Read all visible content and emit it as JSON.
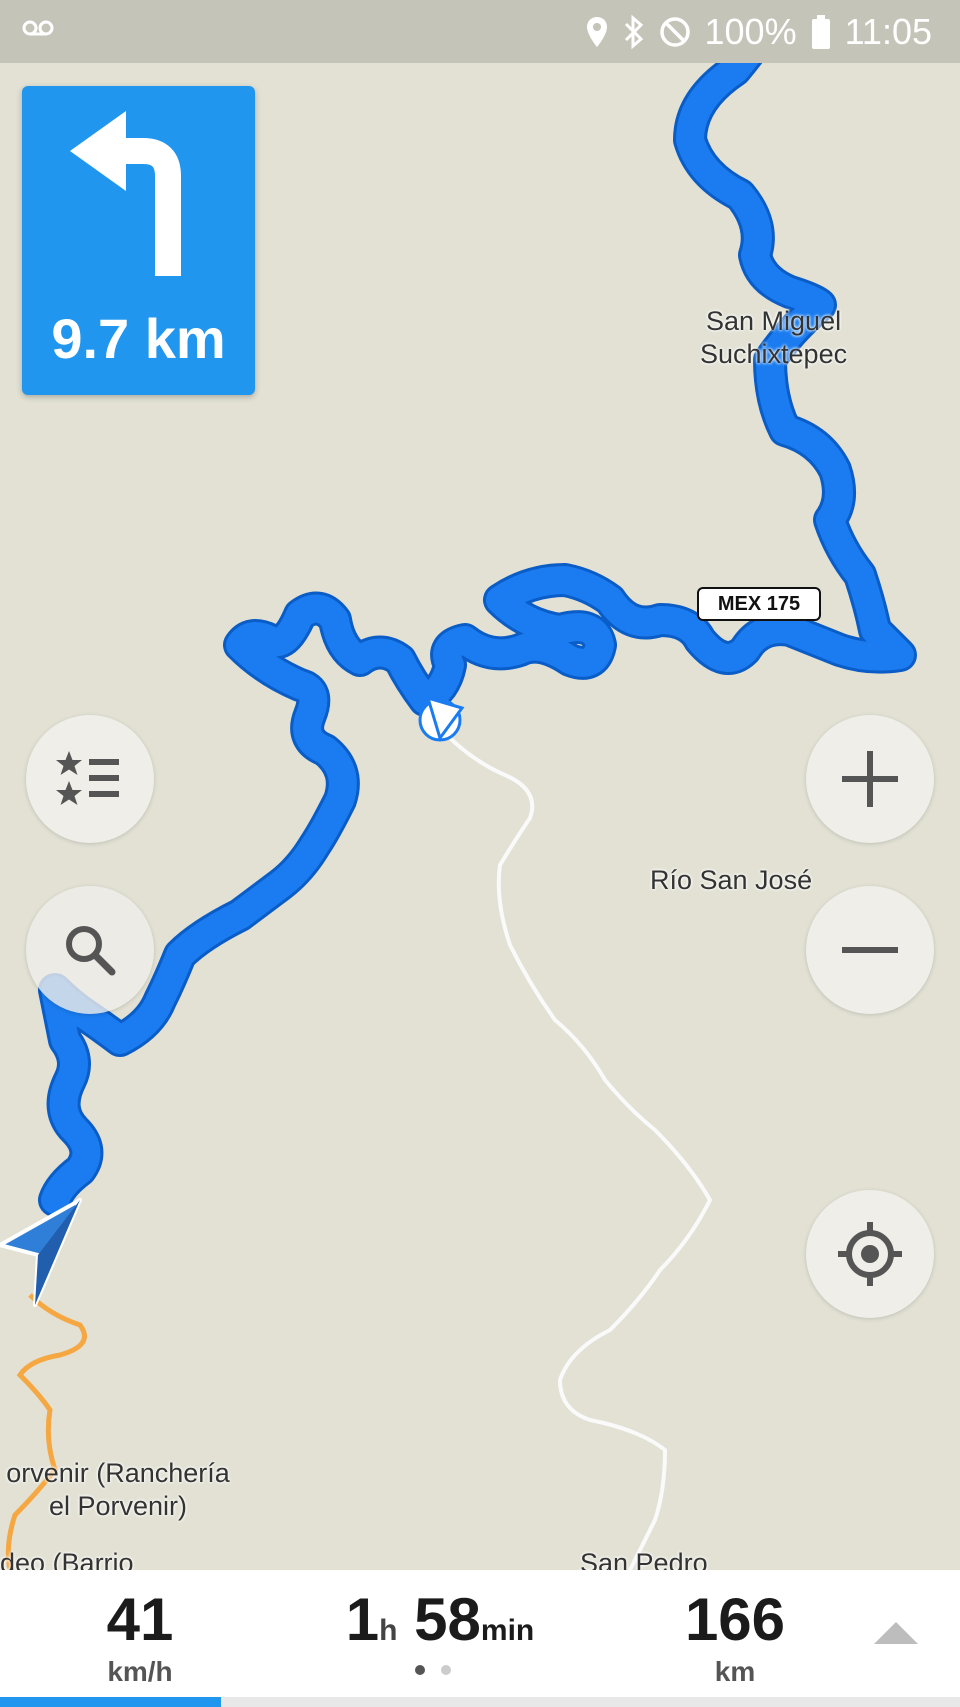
{
  "status_bar": {
    "battery": "100%",
    "time": "11:05",
    "icons": [
      "voicemail-icon",
      "location-icon",
      "bluetooth-icon",
      "do-not-disturb-icon",
      "battery-icon"
    ]
  },
  "navigation": {
    "turn_icon": "turn-left-arrow-icon",
    "turn_distance": "9.7 km"
  },
  "map": {
    "labels": {
      "san_miguel_1": "San Miguel",
      "san_miguel_2": "Suchixtepec",
      "rio_san_jose": "Río San José",
      "porvenir_1": "orvenir (Ranchería",
      "porvenir_2": "el Porvenir)",
      "deo": "deo (Barrio",
      "san_pedro": "San Pedro"
    },
    "road_shield": "MEX 175",
    "route_color": "#1a7cf0",
    "side_road_color": "#f5a742"
  },
  "controls": {
    "favorites_icon": "favorites-list-icon",
    "search_icon": "search-icon",
    "zoom_in_icon": "plus-icon",
    "zoom_out_icon": "minus-icon",
    "locate_icon": "my-location-icon"
  },
  "trip": {
    "speed_value": "41",
    "speed_unit": "km/h",
    "eta_hours": "1",
    "eta_hours_unit": "h",
    "eta_minutes": "58",
    "eta_minutes_unit": "min",
    "distance_value": "166",
    "distance_unit": "km",
    "page_count": 2,
    "active_page": 1,
    "route_progress": 0.23
  },
  "colors": {
    "accent": "#2196ef",
    "map_bg": "#e2e1d4"
  }
}
